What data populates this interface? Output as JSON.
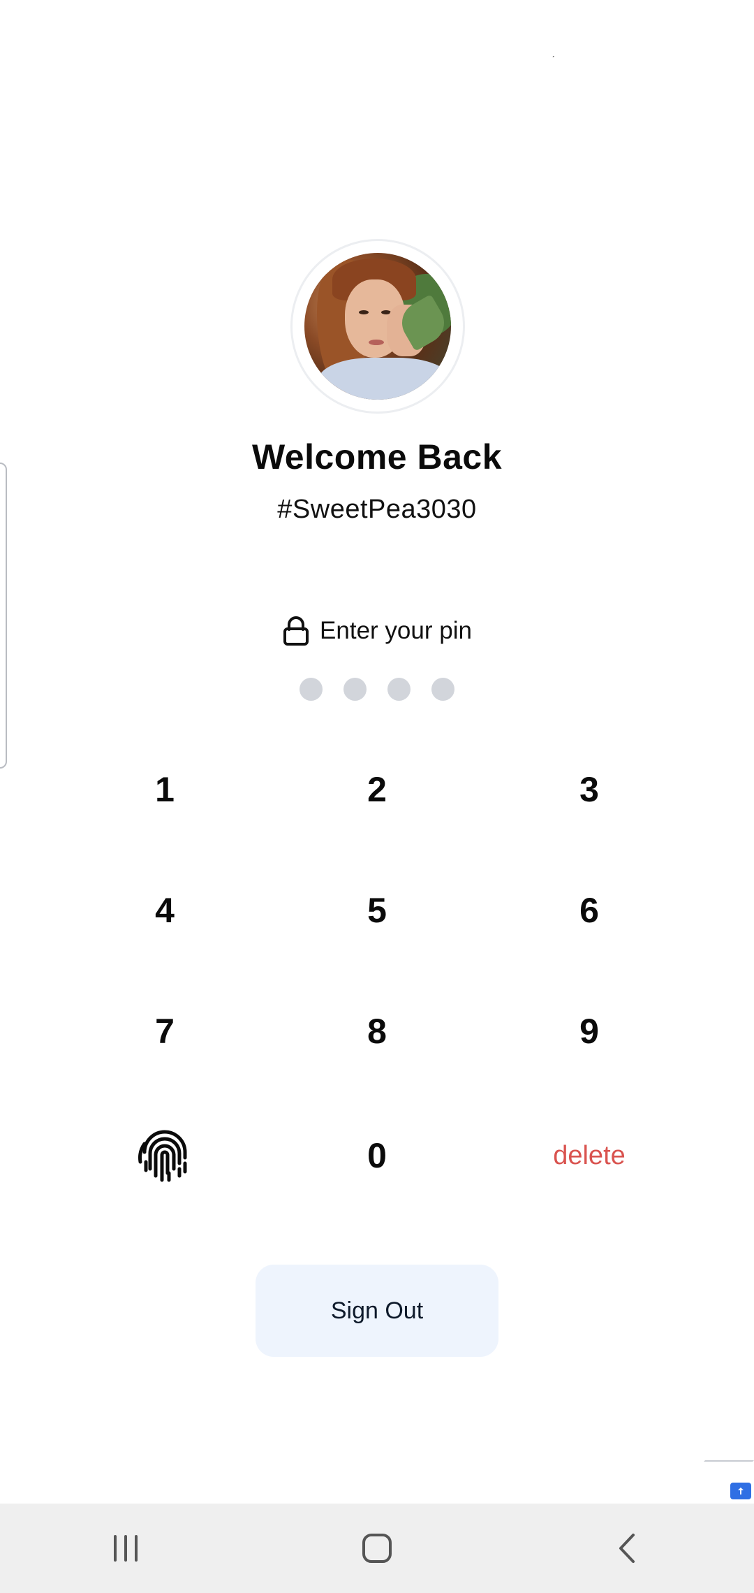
{
  "header": {
    "title": "Welcome Back",
    "username": "#SweetPea3030"
  },
  "pin": {
    "prompt": "Enter your pin",
    "entered": 0,
    "length": 4
  },
  "keypad": {
    "keys": [
      "1",
      "2",
      "3",
      "4",
      "5",
      "6",
      "7",
      "8",
      "9"
    ],
    "zero": "0",
    "delete_label": "delete",
    "biometric_icon": "fingerprint-icon"
  },
  "actions": {
    "sign_out_label": "Sign Out"
  },
  "colors": {
    "delete": "#d9534f",
    "pin_dot_empty": "#d2d5db",
    "sign_out_bg": "#eef4fd",
    "badge": "#2f6fe4",
    "nav_bg": "#efefef"
  },
  "navigation": {
    "recents_icon": "recents-icon",
    "home_icon": "home-icon",
    "back_icon": "back-icon"
  }
}
